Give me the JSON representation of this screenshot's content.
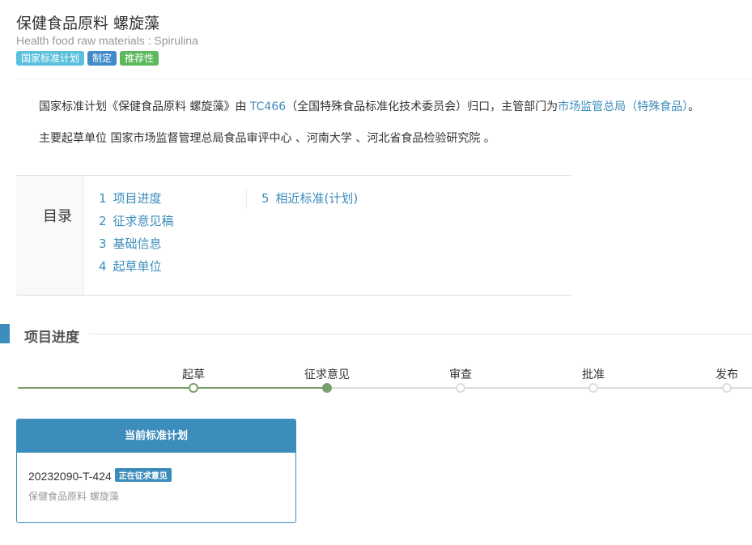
{
  "header": {
    "title": "保健食品原料 螺旋藻",
    "subtitle": "Health food raw materials : Spirulina",
    "badges": [
      {
        "label": "国家标准计划",
        "color": "#5bc0de"
      },
      {
        "label": "制定",
        "color": "#428bca"
      },
      {
        "label": "推荐性",
        "color": "#5cb85c"
      }
    ]
  },
  "description": {
    "line1_prefix": "国家标准计划《保健食品原料 螺旋藻》由 ",
    "committee_code": "TC466",
    "line1_mid": "（全国特殊食品标准化技术委员会）归口，主管部门为",
    "department": "市场监管总局（特殊食品）",
    "line1_suffix": "。",
    "line2": "主要起草单位 国家市场监督管理总局食品审评中心 、河南大学 、河北省食品检验研究院 。"
  },
  "toc": {
    "heading": "目录",
    "items": [
      {
        "num": "1",
        "label": "项目进度"
      },
      {
        "num": "2",
        "label": "征求意见稿"
      },
      {
        "num": "3",
        "label": "基础信息"
      },
      {
        "num": "4",
        "label": "起草单位"
      },
      {
        "num": "5",
        "label": "相近标准(计划)"
      }
    ]
  },
  "progress": {
    "section_title": "项目进度",
    "steps": [
      {
        "label": "起草",
        "state": "done"
      },
      {
        "label": "征求意见",
        "state": "current"
      },
      {
        "label": "审查",
        "state": "pending"
      },
      {
        "label": "批准",
        "state": "pending"
      },
      {
        "label": "发布",
        "state": "pending"
      }
    ]
  },
  "card": {
    "header": "当前标准计划",
    "code": "20232090-T-424",
    "status": "正在征求意见",
    "name": "保健食品原料 螺旋藻"
  },
  "colors": {
    "link": "#3c8dbc",
    "progress_done": "#7a9f6a",
    "card_header": "#3c8dbc"
  }
}
